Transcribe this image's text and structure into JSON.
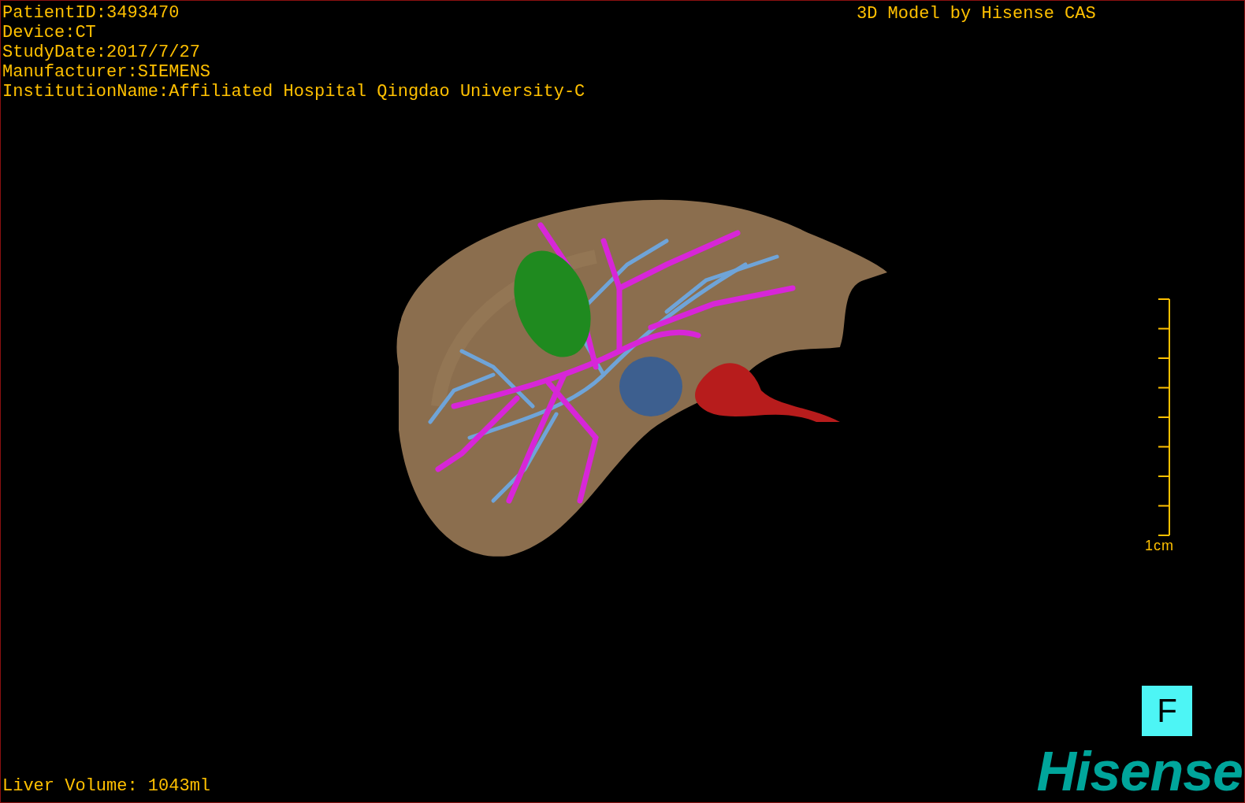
{
  "info_lines": [
    "PatientID:3493470",
    "Device:CT",
    "StudyDate:2017/7/27",
    "Manufacturer:SIEMENS",
    "InstitutionName:Affiliated Hospital Qingdao University-C"
  ],
  "model_credit": "3D Model by Hisense CAS",
  "liver_volume": "Liver Volume: 1043ml",
  "scale": {
    "label": "1cm"
  },
  "view_button": {
    "label": "F"
  },
  "logo": "Hisense"
}
